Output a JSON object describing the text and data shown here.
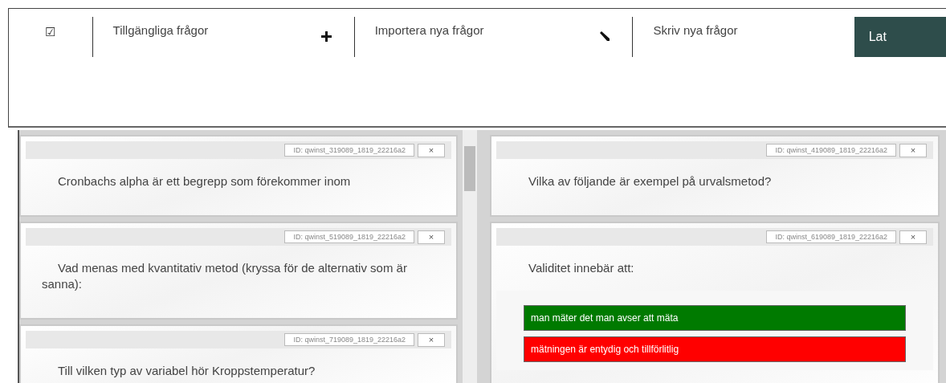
{
  "toolbar": {
    "checkbox_glyph": "☑",
    "items": [
      {
        "label": "Tillgängliga frågor",
        "kind": "add"
      },
      {
        "label": "Importera nya frågor",
        "kind": "edit"
      },
      {
        "label": "Skriv nya frågor",
        "kind": "plain"
      }
    ],
    "button": "Lat"
  },
  "columns": [
    {
      "questions": [
        {
          "id": "ID: qwinst_319089_1819_22216a2",
          "close": "×",
          "text": "Cronbachs alpha är ett begrepp som förekommer inom"
        },
        {
          "id": "ID: qwinst_519089_1819_22216a2",
          "close": "×",
          "text": "Vad menas med kvantitativ metod (kryssa för de alternativ som är sanna):"
        },
        {
          "id": "ID: qwinst_719089_1819_22216a2",
          "close": "×",
          "text": "Till vilken typ av variabel hör Kroppstemperatur?"
        }
      ]
    },
    {
      "questions": [
        {
          "id": "ID: qwinst_419089_1819_22216a2",
          "close": "×",
          "text": "Vilka av följande är exempel på urvalsmetod?"
        },
        {
          "id": "ID: qwinst_619089_1819_22216a2",
          "close": "×",
          "text": "Validitet innebär att:",
          "answers": [
            {
              "text": "man mäter det man avser att mäta",
              "correct": true
            },
            {
              "text": "mätningen är entydig och tillförlitlig",
              "correct": false
            }
          ]
        }
      ]
    }
  ]
}
